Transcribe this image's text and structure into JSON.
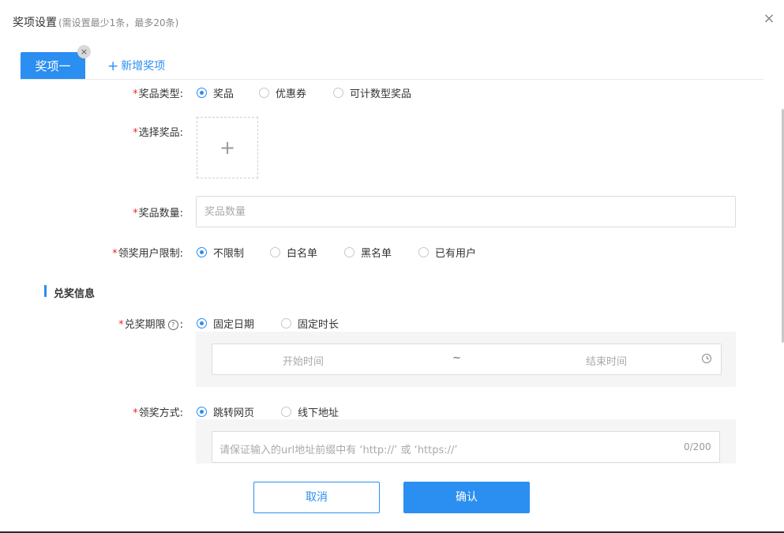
{
  "dialog": {
    "title": "奖项设置",
    "subtitle": "(需设置最少1条，最多20条)",
    "close_glyph": "×"
  },
  "tabs": {
    "active_label": "奖项一",
    "active_close_glyph": "×",
    "add_glyph": "+",
    "add_label": "新增奖项"
  },
  "form": {
    "required_mark": "*",
    "prize_type": {
      "label": "奖品类型:",
      "options": [
        "奖品",
        "优惠券",
        "可计数型奖品"
      ],
      "selected": "奖品"
    },
    "select_prize": {
      "label": "选择奖品:",
      "upload_glyph": "+"
    },
    "prize_quantity": {
      "label": "奖品数量:",
      "placeholder": "奖品数量",
      "value": ""
    },
    "user_limit": {
      "label": "领奖用户限制:",
      "options": [
        "不限制",
        "白名单",
        "黑名单",
        "已有用户"
      ],
      "selected": "不限制"
    }
  },
  "redeem_section": {
    "title": "兑奖信息",
    "period": {
      "label": "兑奖期限",
      "help_glyph": "?",
      "colon": ":",
      "options": [
        "固定日期",
        "固定时长"
      ],
      "selected": "固定日期",
      "start_placeholder": "开始时间",
      "separator": "~",
      "end_placeholder": "结束时间"
    },
    "method": {
      "label": "领奖方式:",
      "options": [
        "跳转网页",
        "线下地址"
      ],
      "selected": "跳转网页",
      "url_placeholder": "请保证输入的url地址前缀中有 ‘http://’ 或 ‘https://’",
      "url_counter": "0/200"
    }
  },
  "footer": {
    "cancel_label": "取消",
    "confirm_label": "确认"
  },
  "colors": {
    "accent": "#2b8ef1",
    "required": "#f5222d",
    "panel": "#f5f5f5"
  },
  "icons": {
    "close": "close-icon",
    "add": "plus-icon",
    "help": "question-circle-icon",
    "clock": "clock-icon"
  }
}
